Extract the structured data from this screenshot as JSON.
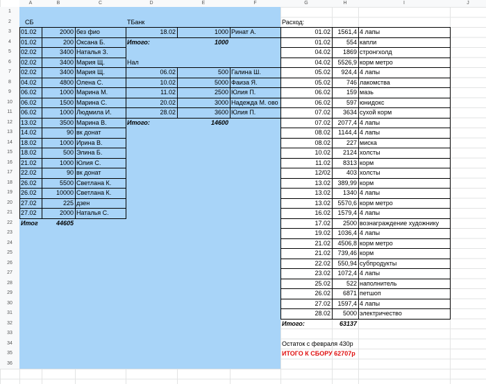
{
  "columns": [
    "A",
    "B",
    "C",
    "D",
    "E",
    "F",
    "G",
    "H",
    "I",
    "J"
  ],
  "rows": [
    "1",
    "2",
    "3",
    "4",
    "5",
    "6",
    "7",
    "8",
    "9",
    "10",
    "11",
    "12",
    "13",
    "14",
    "15",
    "16",
    "17",
    "18",
    "19",
    "20",
    "21",
    "22",
    "23",
    "24",
    "25",
    "26",
    "27",
    "28",
    "29",
    "30",
    "31",
    "32",
    "33",
    "34",
    "35",
    "36"
  ],
  "labels": {
    "sb": "СБ",
    "tbank": "ТБанк",
    "rashod": "Расход:",
    "nal": "Нал",
    "itogo1": "Итого:",
    "itogo1_val": "1000",
    "itogo2": "Итого:",
    "itogo2_val": "14600",
    "itog_sb": "Итог",
    "itog_sb_val": "44605",
    "itogo3": "Итого:",
    "itogo3_val": "63137",
    "ostatok": "Остаток с февраля 430р",
    "itogo_sbor": "ИТОГО К СБОРУ 62707р"
  },
  "sb": [
    [
      "01.02",
      "2000",
      "без фио"
    ],
    [
      "01.02",
      "200",
      "Оксана Б."
    ],
    [
      "02.02",
      "3400",
      "Наталья З."
    ],
    [
      "02.02",
      "3400",
      "Мария Щ."
    ],
    [
      "02.02",
      "3400",
      "Мария Щ."
    ],
    [
      "04.02",
      "4800",
      "Олена С."
    ],
    [
      "06.02",
      "1000",
      "Марина М."
    ],
    [
      "06.02",
      "1500",
      "Марина С."
    ],
    [
      "06.02",
      "1000",
      "Людмила И."
    ],
    [
      "13.02",
      "3500",
      "Марина В."
    ],
    [
      "14.02",
      "90",
      "вк донат"
    ],
    [
      "18.02",
      "1000",
      "Ирина В."
    ],
    [
      "18.02",
      "500",
      "Элина Б."
    ],
    [
      "21.02",
      "1000",
      "Юлия С."
    ],
    [
      "22.02",
      "90",
      "вк донат"
    ],
    [
      "26.02",
      "5500",
      "Светлана К."
    ],
    [
      "26.02",
      "10000",
      "Светлана К."
    ],
    [
      "27.02",
      "225",
      "дзен"
    ],
    [
      "27.02",
      "2000",
      "Наталья С."
    ]
  ],
  "tbank1": [
    [
      "18.02",
      "1000",
      "Ринат А."
    ]
  ],
  "tbank2": [
    [
      "06.02",
      "500",
      "Галина Ш."
    ],
    [
      "10.02",
      "5000",
      "Фаиза Я."
    ],
    [
      "11.02",
      "2500",
      "Юлия П."
    ],
    [
      "20.02",
      "3000",
      "Надежда М. ово"
    ],
    [
      "28.02",
      "3600",
      "Юлия П."
    ]
  ],
  "expenses": [
    [
      "01.02",
      "1561,4",
      "4 лапы"
    ],
    [
      "01.02",
      "554",
      "капли"
    ],
    [
      "04.02",
      "1869",
      "стронгхолд"
    ],
    [
      "04.02",
      "5526,9",
      "корм метро"
    ],
    [
      "05.02",
      "924,4",
      "4 лапы"
    ],
    [
      "05.02",
      "746",
      "лакомства"
    ],
    [
      "06.02",
      "159",
      "мазь"
    ],
    [
      "06.02",
      "597",
      "юнидокс"
    ],
    [
      "07.02",
      "3634",
      "сухой корм"
    ],
    [
      "07.02",
      "2077,4",
      "4 лапы"
    ],
    [
      "08.02",
      "1144,4",
      "4 лапы"
    ],
    [
      "08.02",
      "227",
      "миска"
    ],
    [
      "10.02",
      "2124",
      "холсты"
    ],
    [
      "11.02",
      "8313",
      "корм"
    ],
    [
      "12/02",
      "403",
      "холсты"
    ],
    [
      "13.02",
      "389,99",
      "корм"
    ],
    [
      "13.02",
      "1340",
      "4 лапы"
    ],
    [
      "13.02",
      "5570,6",
      "корм метро"
    ],
    [
      "16.02",
      "1579,4",
      "4 лапы"
    ],
    [
      "17.02",
      "2500",
      "вознаграждение художнику"
    ],
    [
      "19.02",
      "1036,4",
      "4 лапы"
    ],
    [
      "21.02",
      "4506,8",
      "корм метро"
    ],
    [
      "21.02",
      "739,46",
      "корм"
    ],
    [
      "22.02",
      "550,94",
      "субпродукты"
    ],
    [
      "23.02",
      "1072,4",
      "4 лапы"
    ],
    [
      "25.02",
      "522",
      "наполнитель"
    ],
    [
      "26.02",
      "6871",
      "петшоп"
    ],
    [
      "27.02",
      "1597,4",
      "4 лапы"
    ],
    [
      "28.02",
      "5000",
      "электричество"
    ]
  ],
  "colors": {
    "fill": "#a8d4f8",
    "header_bg": "#f8f9fa",
    "grid": "#e2e3e3",
    "red": "#e01010"
  }
}
